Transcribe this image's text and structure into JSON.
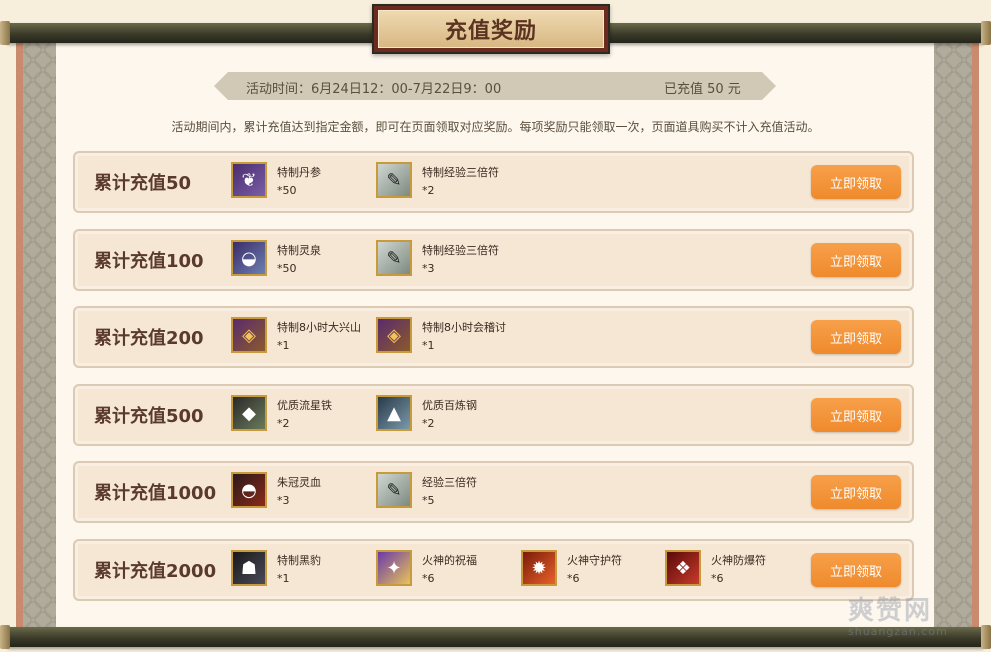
{
  "title": "充值奖励",
  "info": {
    "time": "活动时间：6月24日12：00-7月22日9：00",
    "paid": "已充值 50 元"
  },
  "description": "活动期间内，累计充值达到指定金额，即可在页面领取对应奖励。每项奖励只能领取一次，页面道具购买不计入充值活动。",
  "claim_label": "立即领取",
  "rows": [
    {
      "title": "累计充值50",
      "items": [
        {
          "name": "特制丹参",
          "qty": "*50",
          "icon": "ginseng-icon"
        },
        {
          "name": "特制经验三倍符",
          "qty": "*2",
          "icon": "exp-scroll-icon"
        }
      ]
    },
    {
      "title": "累计充值100",
      "items": [
        {
          "name": "特制灵泉",
          "qty": "*50",
          "icon": "spring-bowl-icon"
        },
        {
          "name": "特制经验三倍符",
          "qty": "*3",
          "icon": "exp-scroll-icon"
        }
      ]
    },
    {
      "title": "累计充值200",
      "items": [
        {
          "name": "特制8小时大兴山",
          "qty": "*1",
          "icon": "token-icon"
        },
        {
          "name": "特制8小时会稽讨",
          "qty": "*1",
          "icon": "token-icon"
        }
      ]
    },
    {
      "title": "累计充值500",
      "items": [
        {
          "name": "优质流星铁",
          "qty": "*2",
          "icon": "ore-icon"
        },
        {
          "name": "优质百炼钢",
          "qty": "*2",
          "icon": "steel-icon"
        }
      ]
    },
    {
      "title": "累计充值1000",
      "items": [
        {
          "name": "朱冠灵血",
          "qty": "*3",
          "icon": "blood-bowl-icon"
        },
        {
          "name": "经验三倍符",
          "qty": "*5",
          "icon": "exp-scroll-icon"
        }
      ]
    },
    {
      "title": "累计充值2000",
      "items": [
        {
          "name": "特制黑豹",
          "qty": "*1",
          "icon": "panther-icon"
        },
        {
          "name": "火神的祝福",
          "qty": "*6",
          "icon": "blessing-icon"
        },
        {
          "name": "火神守护符",
          "qty": "*6",
          "icon": "charm-icon"
        },
        {
          "name": "火神防爆符",
          "qty": "*6",
          "icon": "guard-charm-icon"
        }
      ]
    }
  ],
  "watermark": {
    "main": "爽赞网",
    "sub": "shuangzan.com"
  }
}
